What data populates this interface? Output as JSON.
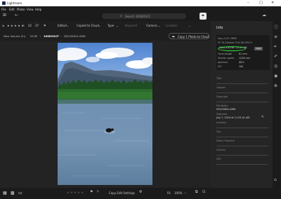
{
  "window": {
    "title": "Lightroom",
    "controls": [
      "–",
      "□",
      "✕"
    ]
  },
  "menu": [
    "File",
    "Edit",
    "Photo",
    "View",
    "Help"
  ],
  "toolbar": {
    "search_placeholder": "Search 100EOSCF"
  },
  "filterbar": {
    "count_22": "22",
    "count_37": "37",
    "edited": "Edited",
    "copied": "Copied to Cloud",
    "type": "Type",
    "keyword": "Keyword",
    "camera": "Camera",
    "location": "Location",
    "more": "..."
  },
  "breadcrumb": [
    "New Volume (E:)",
    "DCIM",
    "100EOSCF",
    "DSCD0624.ARW"
  ],
  "copy_button": "Copy 1 Photo to Cloud",
  "bottombar": {
    "copy_edit": "Copy Edit Settings",
    "fit": "Fit",
    "zoom": "100%"
  },
  "info": {
    "header": "Info",
    "camera": {
      "model": "Sony ILCE-7RM5",
      "lens": "FE 70-200mm F2.8 GM OSS II",
      "resolution": "9504 x 6336 · 51.93 MB",
      "raw_badge": "ARW",
      "rows": [
        {
          "label": "Focal length",
          "value": "81 mm"
        },
        {
          "label": "Shutter speed",
          "value": "1/320 sec"
        },
        {
          "label": "Aperture",
          "value": "f/8.0"
        },
        {
          "label": "ISO",
          "value": "100"
        }
      ]
    },
    "fields": [
      {
        "label": "Title",
        "value": ""
      },
      {
        "label": "Caption",
        "value": ""
      },
      {
        "label": "Copyright",
        "value": ""
      },
      {
        "label": "File Name",
        "value": "DSCD0624.ARW"
      },
      {
        "label": "Captured",
        "value": "July 7, 2024 at 11:53:41 AM"
      },
      {
        "label": "Location",
        "value": ""
      },
      {
        "label": "City",
        "value": ""
      },
      {
        "label": "State / Province",
        "value": ""
      },
      {
        "label": "Country",
        "value": ""
      },
      {
        "label": "GPS",
        "value": ""
      }
    ]
  },
  "colors": {
    "highlight": "#2edb3a",
    "bg": "#1e1e1e",
    "panel": "#252525",
    "accent": "#3b82f6"
  }
}
